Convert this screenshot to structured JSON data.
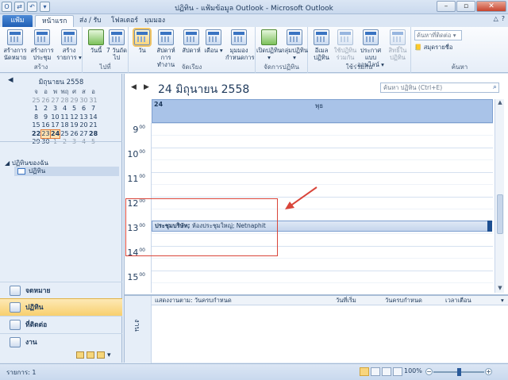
{
  "window": {
    "title": "ปฏิทิน - แฟ้มข้อมูล Outlook - Microsoft Outlook"
  },
  "tabs": [
    "แฟ้ม",
    "หน้าแรก",
    "ส่ง / รับ",
    "โฟลเดอร์",
    "มุมมอง"
  ],
  "ribbon": {
    "new": {
      "label": "สร้าง",
      "buttons": [
        "สร้างการนัดหมาย",
        "สร้างการประชุม",
        "สร้างรายการ ▾"
      ]
    },
    "goto": {
      "label": "ไปที่",
      "buttons": [
        "วันนี้",
        "7 วันถัดไป"
      ]
    },
    "arrange": {
      "label": "จัดเรียง",
      "buttons": [
        "วัน",
        "สัปดาห์การทำงาน",
        "สัปดาห์",
        "เดือน ▾",
        "มุมมองกำหนดการ"
      ]
    },
    "manage": {
      "label": "จัดการปฏิทิน",
      "buttons": [
        "เปิดปฏิทิน ▾",
        "กลุ่มปฏิทิน ▾"
      ]
    },
    "share": {
      "label": "ใช้ร่วมกัน",
      "buttons": [
        "อีเมลปฏิทิน",
        "ใช้ปฏิทินร่วมกัน",
        "ประกาศแบบออนไลน์ ▾",
        "สิทธิ์ในปฏิทิน"
      ]
    },
    "find": {
      "label": "ค้นหา",
      "search_placeholder": "ค้นหาที่ติดต่อ ▾",
      "address_book": "สมุดรายชื่อ"
    }
  },
  "mini_calendar": {
    "month_label": "มิถุนายน 2558",
    "weekdays": [
      "จ",
      "อ",
      "พ",
      "พฤ",
      "ศ",
      "ส",
      "อ"
    ],
    "days": [
      [
        "25",
        "26",
        "27",
        "28",
        "29",
        "30",
        "31"
      ],
      [
        "1",
        "2",
        "3",
        "4",
        "5",
        "6",
        "7"
      ],
      [
        "8",
        "9",
        "10",
        "11",
        "12",
        "13",
        "14"
      ],
      [
        "15",
        "16",
        "17",
        "18",
        "19",
        "20",
        "21"
      ],
      [
        "22",
        "23",
        "24",
        "25",
        "26",
        "27",
        "28"
      ],
      [
        "29",
        "30",
        "1",
        "2",
        "3",
        "4",
        "5"
      ]
    ]
  },
  "my_calendars": {
    "group": "◢ ปฏิทินของฉัน",
    "item": "ปฏิทิน"
  },
  "nav": [
    "จดหมาย",
    "ปฏิทิน",
    "ที่ติดต่อ",
    "งาน"
  ],
  "day_view": {
    "title": "24 มิถุนายน 2558",
    "search_placeholder": "ค้นหา ปฏิทิน (Ctrl+E)",
    "day_number": "24",
    "day_name": "พุธ",
    "hours": [
      "9",
      "10",
      "11",
      "12",
      "13",
      "14",
      "15"
    ],
    "appointment": {
      "title": "ประชุมบริษัท;",
      "detail": " ห้องประชุมใหญ่; Netnaphit"
    }
  },
  "tasks": {
    "side_label": "งาน",
    "columns": [
      "แสดงงานตาม: วันครบกำหนด",
      "วันที่เริ่ม",
      "วันครบกำหนด",
      "เวลาเตือน"
    ]
  },
  "status": {
    "items": "รายการ: 1",
    "zoom": "100%"
  }
}
